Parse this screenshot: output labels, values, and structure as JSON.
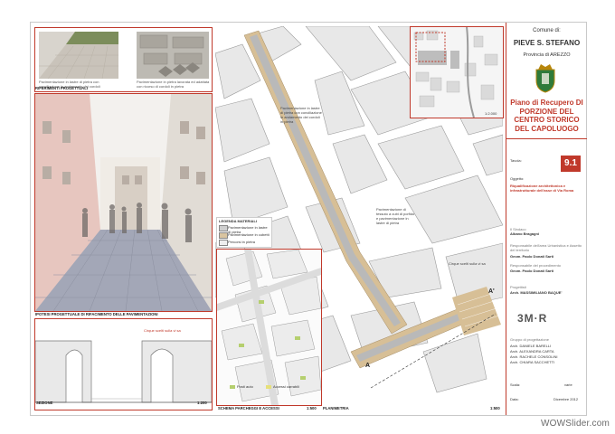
{
  "top_captions": {
    "left": "Pavimentazione in lastre di pietra con conciliazione in andamento dei cordoli",
    "right": "Pavimentazione in pietra lavorata ed adattata con ricorso di cordoli in pietra"
  },
  "section_titles": {
    "riferimenti": "RIFERIMENTI PROGETTUALI",
    "ipotesi": "IPOTESI PROGETTUALE DI RIFACIMENTO DELLE PAVIMENTAZIONI",
    "sezione": "SEZIONE",
    "sezione_scale": "1:200",
    "schema": "SCHEMA PARCHEGGI E ACCESSI",
    "schema_scale": "1:500",
    "planimetria": "PLANIMETRIA",
    "plan_scale": "1:500",
    "inset_scale": "1:2.000"
  },
  "plan_notes": {
    "note_1": "Pavimentazione in lastre di pietra con conciliazione in andamento dei cordoli in pietra",
    "note_2": "Pavimentazione di tessuto a cubi di porfido e pavimentazione in lastre di pietra",
    "note_3": "Cirque scelti sulla vi sa",
    "section_mark": "A",
    "section_mark_2": "A'"
  },
  "legend": {
    "title": "LEGENDA MATERIALI",
    "items": [
      "Pavimentazione in lastre di pietra",
      "Pavimentazione in cubetti",
      "Percorsi in pietra"
    ],
    "colors": [
      "#cfcfcf",
      "#d9c4a0",
      "#eeeeee"
    ]
  },
  "schema_legend": [
    "Posti auto",
    "Accessi carrabili"
  ],
  "section_label": "Cirque scelti sulla vi sa",
  "title_block": {
    "comune": "Comune di:",
    "town": "PIEVE S. STEFANO",
    "provincia": "Provincia di AREZZO",
    "plan_title": "Piano di Recupero DI PORZIONE DEL CENTRO STORICO DEL CAPOLUOGO",
    "tavola_label": "Tavola:",
    "tavola_number": "9.1",
    "oggetto_label": "Oggetto:",
    "oggetto": "Riqualificazione architettonica e infrastrutturale dell'asse di Via Roma",
    "sindaco_label": "Il Sindaco",
    "sindaco": "Albano Bragagni",
    "resp_area_label": "Responsabile dell'area Urbanistica e Assetto del territorio",
    "resp_area": "Geom. Paolo Donati Sarti",
    "resp_proc_label": "Responsabile del procedimento",
    "resp_proc": "Geom. Paolo Donati Sarti",
    "progettisti_label": "Progettisti",
    "progettista": "Arch. MASSIMILIANO BAQUE'",
    "logo": "3M·R",
    "gruppo_label": "Gruppo di progettazione",
    "gruppo": [
      "Arch. DANIELE BARELLI",
      "Arch. ALEXANDRA CARTA",
      "Arch. RACHELE CONSOLINI",
      "Arch. CHIARA SACCHETTI"
    ],
    "scala_label": "Scala:",
    "scala": "varie",
    "data_label": "Data:",
    "data": "Dicembre 2012"
  },
  "watermark": "WOWSlider.com"
}
